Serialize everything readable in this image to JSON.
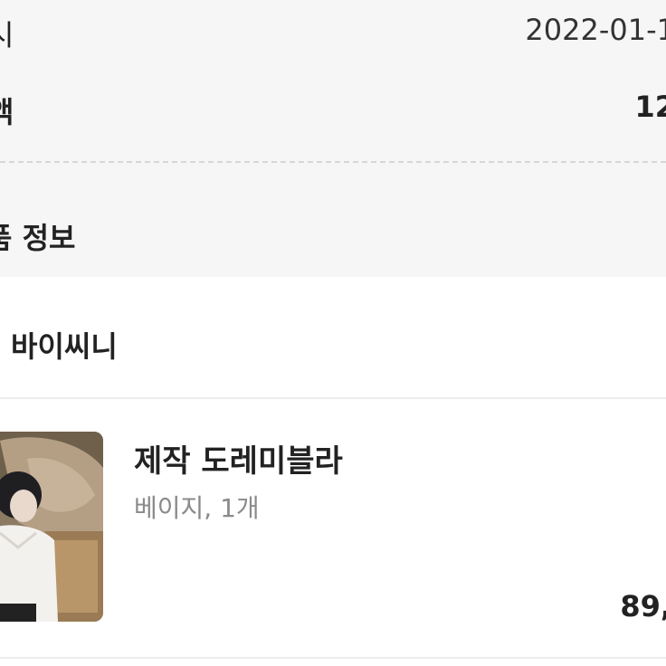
{
  "order_summary": {
    "date_label": "시",
    "date_value": "2022-01-1",
    "price_label": "액",
    "price_value": "12"
  },
  "section": {
    "title": "품 정보"
  },
  "seller": {
    "name": "바이씨니"
  },
  "product": {
    "name": "제작 도레미블라",
    "option": "베이지, 1개",
    "price": "89,",
    "thumbnail_icon": "product-photo"
  },
  "colors": {
    "background": "#f6f6f6",
    "card": "#ffffff",
    "text": "#222222",
    "muted": "#8a8a8a",
    "divider": "#ececec"
  }
}
